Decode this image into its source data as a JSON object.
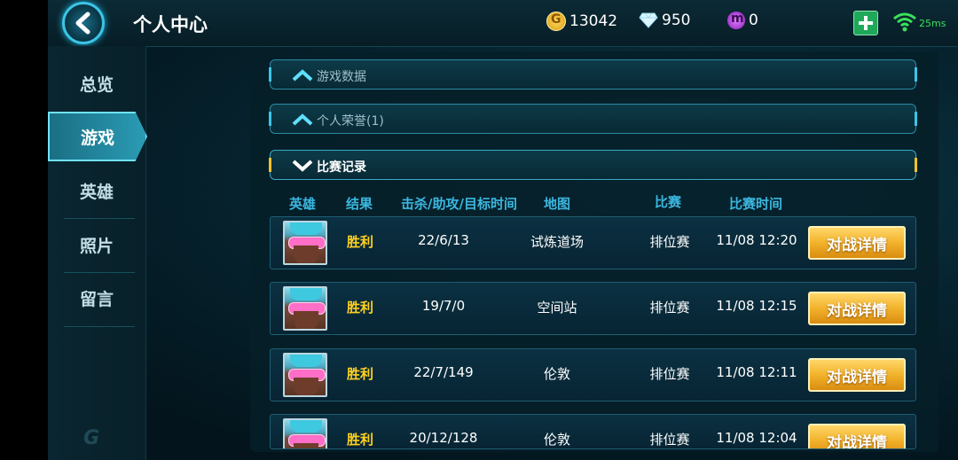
{
  "header": {
    "title": "个人中心",
    "gold": "13042",
    "diamonds": "950",
    "m_coins": "0",
    "ping": "25ms"
  },
  "sidebar": {
    "items": [
      {
        "label": "总览"
      },
      {
        "label": "游戏",
        "active": true
      },
      {
        "label": "英雄"
      },
      {
        "label": "照片"
      },
      {
        "label": "留言"
      }
    ]
  },
  "sections": [
    {
      "label": "游戏数据",
      "state": "collapsed"
    },
    {
      "label": "个人荣誉(1)",
      "state": "collapsed"
    },
    {
      "label": "比赛记录",
      "state": "expanded"
    }
  ],
  "table": {
    "columns": [
      "英雄",
      "结果",
      "击杀/助攻/目标时间",
      "地图",
      "比赛",
      "比赛时间"
    ],
    "button_label": "对战详情",
    "rows": [
      {
        "result": "胜利",
        "kda": "22/6/13",
        "map": "试炼道场",
        "mode": "排位赛",
        "time": "11/08 12:20"
      },
      {
        "result": "胜利",
        "kda": "19/7/0",
        "map": "空间站",
        "mode": "排位赛",
        "time": "11/08 12:15"
      },
      {
        "result": "胜利",
        "kda": "22/7/149",
        "map": "伦敦",
        "mode": "排位赛",
        "time": "11/08 12:11"
      },
      {
        "result": "胜利",
        "kda": "20/12/128",
        "map": "伦敦",
        "mode": "排位赛",
        "time": "11/08 12:04"
      }
    ]
  },
  "colors": {
    "accent": "#3cc4e6",
    "result_win": "#ffd21f",
    "button_gold": "#f2b22b"
  }
}
